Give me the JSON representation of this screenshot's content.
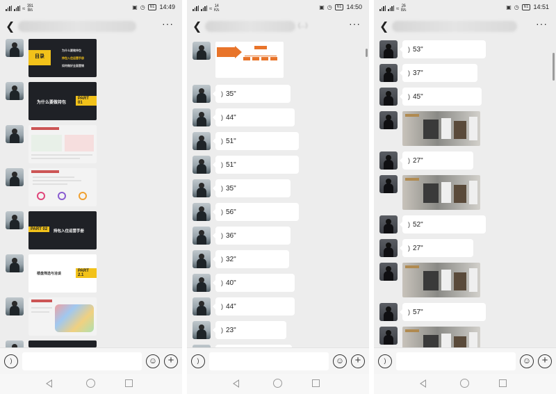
{
  "phones": [
    {
      "status": {
        "speed": "391\nB/s",
        "battery": "61",
        "time": "14:49"
      },
      "title_tail": "",
      "slides": [
        {
          "kind": "menu",
          "badge": "目录",
          "items": [
            "为什么要做持包",
            "持包入住运营手册",
            "如何做好全面营销"
          ]
        },
        {
          "kind": "part",
          "heading": "为什么要做持包",
          "part": "PART  01"
        },
        {
          "kind": "doc"
        },
        {
          "kind": "doc2"
        },
        {
          "kind": "part2",
          "part": "PART  02",
          "heading": "持包入住运营手册"
        },
        {
          "kind": "part21",
          "heading": "楼盘筛选与洽谈",
          "part": "PART 2.1"
        },
        {
          "kind": "map"
        },
        {
          "kind": "partial"
        }
      ]
    },
    {
      "status": {
        "speed": "14\nK/s",
        "battery": "61",
        "time": "14:50"
      },
      "title_tail": "(...)",
      "durations": [
        "35\"",
        "44\"",
        "51\"",
        "51\"",
        "35\"",
        "56\"",
        "36\"",
        "32\"",
        "40\"",
        "44\"",
        "23\""
      ]
    },
    {
      "status": {
        "speed": "26\nB/s",
        "battery": "61",
        "time": "14:51"
      },
      "title_tail": "",
      "items": [
        {
          "type": "voice",
          "text": "53\""
        },
        {
          "type": "voice",
          "text": "37\""
        },
        {
          "type": "voice",
          "text": "45\""
        },
        {
          "type": "photo"
        },
        {
          "type": "voice",
          "text": "27\""
        },
        {
          "type": "photo"
        },
        {
          "type": "voice",
          "text": "52\""
        },
        {
          "type": "voice",
          "text": "27\""
        },
        {
          "type": "photo"
        },
        {
          "type": "voice",
          "text": "57\""
        },
        {
          "type": "photo"
        }
      ]
    }
  ],
  "icons": {
    "back": "chevron-left-icon",
    "more": "more-icon",
    "voice": "voice-icon",
    "emoji": "emoji-icon",
    "plus": "plus-icon"
  },
  "colors": {
    "accent_yellow": "#f2c21a",
    "chat_bg": "#ededed",
    "bubble": "#ffffff"
  }
}
